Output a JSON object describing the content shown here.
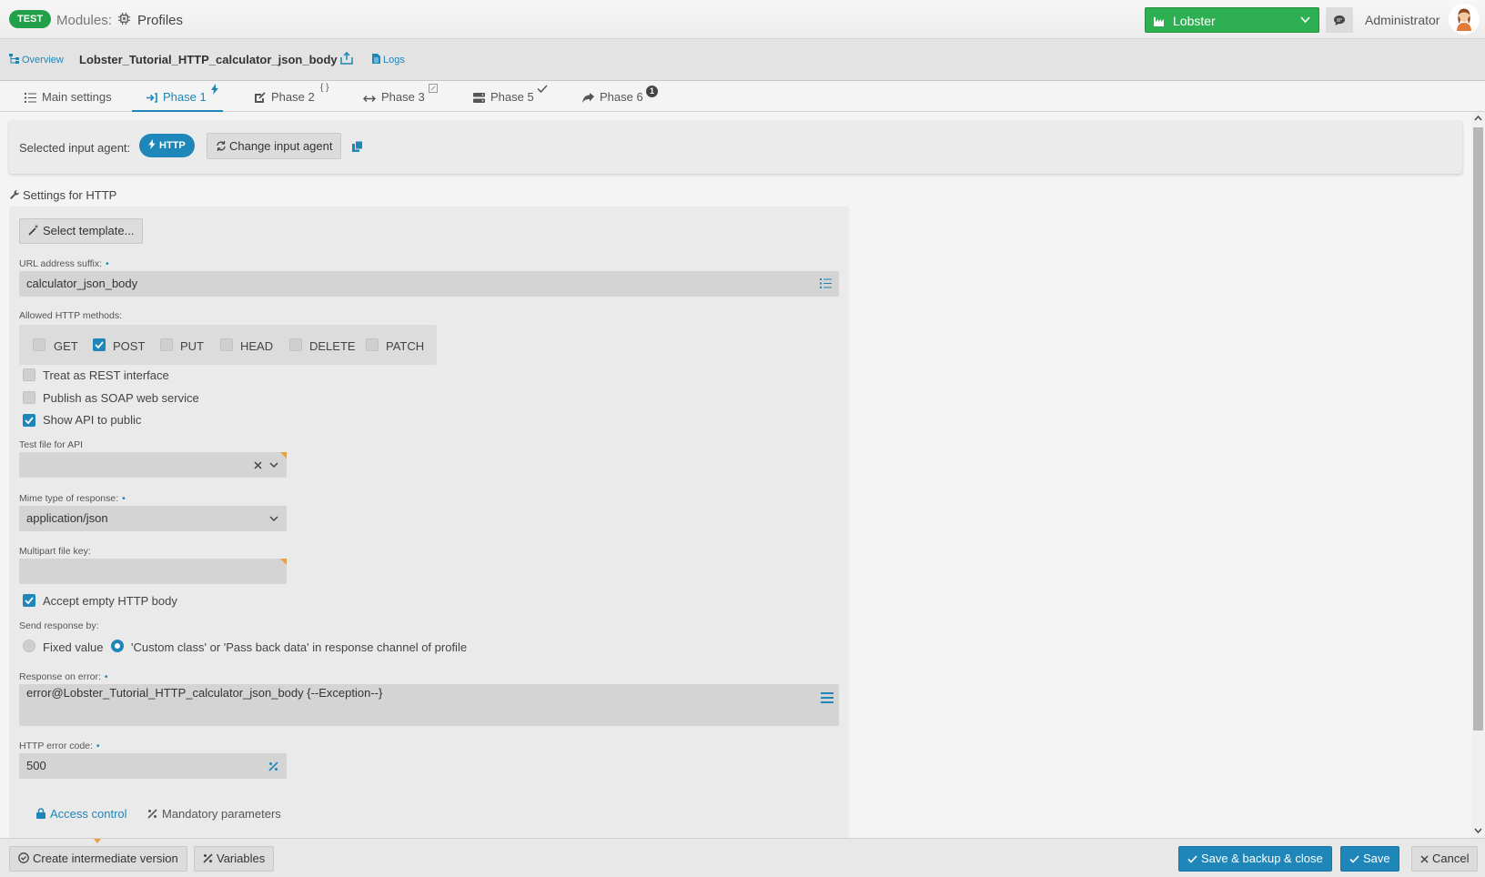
{
  "topbar": {
    "env_badge": "TEST",
    "modules_label": "Modules:",
    "profiles_label": "Profiles",
    "instance": "Lobster",
    "user": "Administrator"
  },
  "subbar": {
    "overview": "Overview",
    "profile_name": "Lobster_Tutorial_HTTP_calculator_json_body",
    "logs": "Logs"
  },
  "tabs": [
    {
      "label": "Main settings",
      "active": false
    },
    {
      "label": "Phase 1",
      "active": true
    },
    {
      "label": "Phase 2",
      "active": false
    },
    {
      "label": "Phase 3",
      "active": false
    },
    {
      "label": "Phase 5",
      "active": false
    },
    {
      "label": "Phase 6",
      "active": false,
      "badge": "1"
    }
  ],
  "agent": {
    "label": "Selected input agent:",
    "value": "HTTP",
    "change_button": "Change input agent"
  },
  "settings": {
    "title": "Settings for HTTP",
    "select_template": "Select template...",
    "url_suffix_label": "URL address suffix:",
    "url_suffix_value": "calculator_json_body",
    "methods_label": "Allowed HTTP methods:",
    "methods": [
      {
        "label": "GET",
        "checked": false
      },
      {
        "label": "POST",
        "checked": true
      },
      {
        "label": "PUT",
        "checked": false
      },
      {
        "label": "HEAD",
        "checked": false
      },
      {
        "label": "DELETE",
        "checked": false
      },
      {
        "label": "PATCH",
        "checked": false
      }
    ],
    "rest_label": "Treat as REST interface",
    "rest_checked": false,
    "soap_label": "Publish as SOAP web service",
    "soap_checked": false,
    "public_label": "Show API to public",
    "public_checked": true,
    "test_file_label": "Test file for API",
    "test_file_value": "",
    "mime_label": "Mime type of response:",
    "mime_value": "application/json",
    "multipart_label": "Multipart file key:",
    "multipart_value": "",
    "accept_empty_label": "Accept empty HTTP body",
    "accept_empty_checked": true,
    "send_response_label": "Send response by:",
    "response_fixed": "Fixed value",
    "response_custom": "'Custom class' or 'Pass back data' in response channel of profile",
    "response_selected": "custom",
    "error_response_label": "Response on error:",
    "error_response_value": "error@Lobster_Tutorial_HTTP_calculator_json_body {--Exception--}",
    "error_code_label": "HTTP error code:",
    "error_code_value": "500",
    "subtab_access": "Access control",
    "subtab_mandatory": "Mandatory parameters"
  },
  "bottom": {
    "intermediate": "Create intermediate version",
    "variables": "Variables",
    "save_backup_close": "Save & backup & close",
    "save": "Save",
    "cancel": "Cancel"
  },
  "colors": {
    "accent": "#1e86b8",
    "instance_green": "#2eb052",
    "env_green": "#22a049",
    "warning_corner": "#e8a040"
  }
}
